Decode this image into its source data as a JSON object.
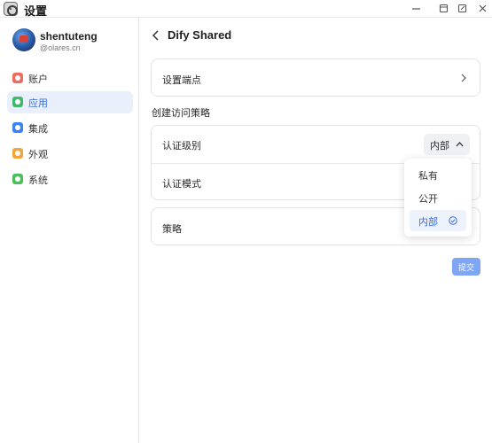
{
  "window": {
    "title": "设置",
    "controls": [
      "minimize-icon",
      "restore-icon",
      "popout-icon",
      "close-icon"
    ]
  },
  "user": {
    "name": "shentuteng",
    "domain": "@olares.cn"
  },
  "sidebar": {
    "items": [
      {
        "label": "账户",
        "icon": "account-icon",
        "color": "#ef6b5e",
        "active": false
      },
      {
        "label": "应用",
        "icon": "apps-icon",
        "color": "#3fb96b",
        "active": true
      },
      {
        "label": "集成",
        "icon": "integration-icon",
        "color": "#3b82f6",
        "active": false
      },
      {
        "label": "外观",
        "icon": "appearance-icon",
        "color": "#f5a33b",
        "active": false
      },
      {
        "label": "系统",
        "icon": "system-icon",
        "color": "#4cbf5a",
        "active": false
      }
    ]
  },
  "page": {
    "title": "Dify Shared",
    "set_endpoint_label": "设置端点",
    "policy_section_title": "创建访问策略",
    "auth_level_label": "认证级别",
    "auth_level_value": "内部",
    "auth_mode_label": "认证模式",
    "policy_label": "策略",
    "submit_label": "提交"
  },
  "dropdown": {
    "options": [
      {
        "label": "私有",
        "selected": false
      },
      {
        "label": "公开",
        "selected": false
      },
      {
        "label": "内部",
        "selected": true
      }
    ]
  },
  "colors": {
    "accent": "#3a6ed8",
    "active_bg": "#e9f0fc",
    "submit_bg": "#7ea6f3"
  }
}
